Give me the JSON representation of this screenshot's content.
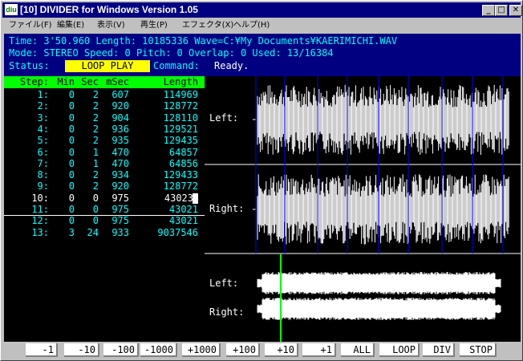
{
  "window": {
    "icon_text": "diu",
    "title": "[10] DIVIDER for Windows Version 1.05"
  },
  "menu": [
    "ファイル(F)",
    "編集(E)",
    "表示(V)",
    "再生(P)",
    "エフェクタ(X)",
    "ヘルプ(H)"
  ],
  "info": {
    "line1": "Time: 3'50.960 Length: 10185336 Wave=C:¥My Documents¥KAERIMICHI.WAV",
    "line2": "Mode: STEREO   Speed:    0   Pitch:   0   Overlap:  0    Used:       13/16384",
    "status_label": "Status:",
    "status_value": "LOOP PLAY",
    "command_label": "Command:",
    "command_value": "Ready."
  },
  "list": {
    "columns": [
      "Step:",
      "Min",
      "Sec",
      "mSec",
      "Length"
    ],
    "rows": [
      [
        "1:",
        "0",
        "2",
        "607",
        "114969"
      ],
      [
        "2:",
        "0",
        "2",
        "920",
        "128772"
      ],
      [
        "3:",
        "0",
        "2",
        "904",
        "128110"
      ],
      [
        "4:",
        "0",
        "2",
        "936",
        "129521"
      ],
      [
        "5:",
        "0",
        "2",
        "935",
        "129435"
      ],
      [
        "6:",
        "0",
        "1",
        "470",
        "64857"
      ],
      [
        "7:",
        "0",
        "1",
        "470",
        "64856"
      ],
      [
        "8:",
        "0",
        "2",
        "934",
        "129433"
      ],
      [
        "9:",
        "0",
        "2",
        "920",
        "128772"
      ],
      [
        "10:",
        "0",
        "0",
        "975",
        "43023"
      ],
      [
        "11:",
        "0",
        "0",
        "975",
        "43021"
      ],
      [
        "12:",
        "0",
        "0",
        "975",
        "43021"
      ],
      [
        "13:",
        "3",
        "24",
        "933",
        "9037546"
      ]
    ],
    "selected_index": 9
  },
  "waveform": {
    "left_label": "Left:",
    "right_label": "Right:",
    "overview_left_label": "Left:",
    "overview_right_label": "Right:"
  },
  "buttons": [
    "-1",
    "-10",
    "-100",
    "-1000",
    "+1000",
    "+100",
    "+10",
    "+1",
    "ALL",
    "LOOP",
    "DIV",
    "STOP"
  ],
  "colors": {
    "title_bar": "#000080",
    "info_bg": "#000080",
    "info_text": "#00ffff",
    "status_highlight": "#ffff00",
    "list_header": "#00ff00",
    "marker": "#0000ff",
    "playhead": "#00ff00"
  }
}
